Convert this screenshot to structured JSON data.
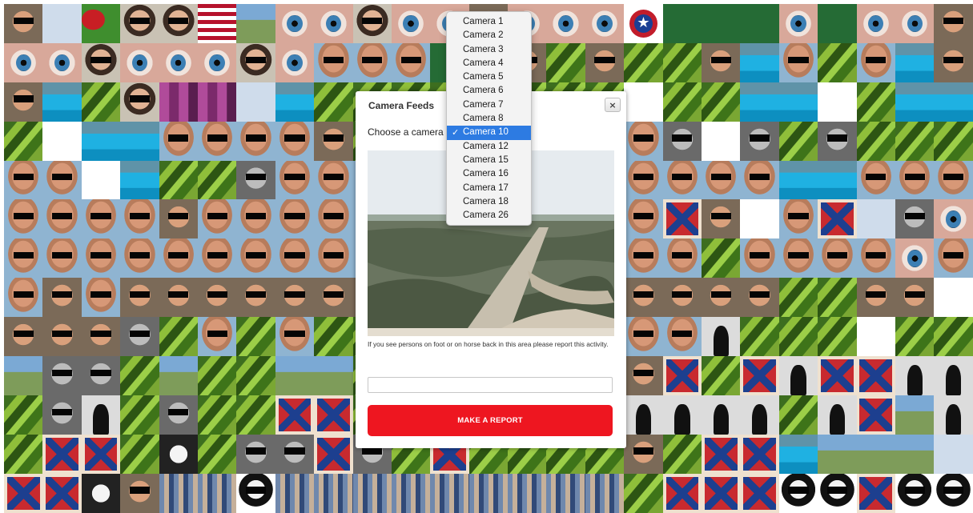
{
  "modal": {
    "title": "Camera Feeds",
    "close_icon": "×",
    "choose_label": "Choose a camera",
    "instructions": "If you see persons on foot or on horse back in this area please report this activity.",
    "report_input_value": "",
    "report_button_label": "MAKE A REPORT"
  },
  "dropdown": {
    "selected": "Camera 10",
    "options": [
      "Camera 1",
      "Camera 2",
      "Camera 3",
      "Camera 4",
      "Camera 5",
      "Camera 6",
      "Camera 7",
      "Camera 8",
      "Camera 10",
      "Camera 12",
      "Camera 15",
      "Camera 16",
      "Camera 17",
      "Camera 18",
      "Camera 26"
    ],
    "check_icon": "✓"
  },
  "colors": {
    "report_button": "#ee1620",
    "selected_option": "#2d7be2"
  },
  "mosaic": {
    "columns": 25,
    "rows": [
      [
        "face",
        "avatar",
        "straw",
        "face2",
        "face2",
        "usa",
        "road",
        "eye",
        "eye",
        "face2",
        "eye",
        "eye",
        "face",
        "eye",
        "eye",
        "eye",
        "star",
        "green",
        "green",
        "green",
        "eye",
        "green",
        "eye",
        "eye",
        "face"
      ],
      [
        "eye",
        "eye",
        "face2",
        "eye",
        "eye",
        "eye",
        "face2",
        "eye",
        "bald",
        "bald",
        "bald",
        "green",
        "eye",
        "face",
        "leaf",
        "face",
        "leaf",
        "leaf",
        "face",
        "pool",
        "bald",
        "leaf",
        "bald",
        "pool",
        "face"
      ],
      [
        "face",
        "pool",
        "leaf",
        "face2",
        "pink",
        "pink",
        "avatar",
        "pool",
        "leaf",
        "leaf",
        "leaf",
        "leaf",
        "leaf",
        "leaf",
        "leaf",
        "leaf",
        "sketch",
        "leaf",
        "leaf",
        "pool",
        "pool",
        "sketch",
        "leaf",
        "pool",
        "pool"
      ],
      [
        "leaf",
        "sketch",
        "pool",
        "pool",
        "bald",
        "bald",
        "bald",
        "bald",
        "face",
        "leaf",
        "leaf",
        "leaf",
        "leaf",
        "leaf",
        "leaf",
        "leaf",
        "bald",
        "gray",
        "sketch",
        "gray",
        "leaf",
        "gray",
        "leaf",
        "leaf",
        "leaf"
      ],
      [
        "bald",
        "bald",
        "sketch",
        "pool",
        "leaf",
        "leaf",
        "gray",
        "bald",
        "bald",
        "bald",
        "bald",
        "bald",
        "bald",
        "bald",
        "bald",
        "bald",
        "bald",
        "bald",
        "bald",
        "bald",
        "pool",
        "pool",
        "bald",
        "bald",
        "bald"
      ],
      [
        "bald",
        "bald",
        "bald",
        "bald",
        "face",
        "bald",
        "bald",
        "bald",
        "bald",
        "bald",
        "bald",
        "bald",
        "bald",
        "bald",
        "bald",
        "bald",
        "bald",
        "flag",
        "face",
        "sketch",
        "bald",
        "flag",
        "avatar",
        "gray",
        "eye"
      ],
      [
        "bald",
        "bald",
        "bald",
        "bald",
        "bald",
        "bald",
        "bald",
        "bald",
        "bald",
        "bald",
        "bald",
        "bald",
        "bald",
        "bald",
        "bald",
        "bald",
        "bald",
        "bald",
        "leaf",
        "bald",
        "bald",
        "bald",
        "bald",
        "eye",
        "bald"
      ],
      [
        "bald",
        "face",
        "bald",
        "face",
        "face",
        "face",
        "face",
        "face",
        "face",
        "face",
        "face",
        "face",
        "face",
        "face",
        "face",
        "face",
        "face",
        "face",
        "face",
        "face",
        "leaf",
        "leaf",
        "face",
        "face",
        "sketch"
      ],
      [
        "face",
        "face",
        "face",
        "gray",
        "leaf",
        "bald",
        "leaf",
        "bald",
        "leaf",
        "leaf",
        "leaf",
        "leaf",
        "leaf",
        "leaf",
        "leaf",
        "leaf",
        "bald",
        "bald",
        "silh",
        "leaf",
        "leaf",
        "leaf",
        "sketch",
        "leaf",
        "leaf"
      ],
      [
        "road",
        "gray",
        "gray",
        "leaf",
        "road",
        "leaf",
        "leaf",
        "road",
        "road",
        "leaf",
        "leaf",
        "leaf",
        "leaf",
        "leaf",
        "leaf",
        "leaf",
        "face",
        "flag",
        "leaf",
        "flag",
        "silh",
        "flag",
        "flag",
        "silh",
        "silh"
      ],
      [
        "leaf",
        "gray",
        "silh",
        "leaf",
        "gray",
        "leaf",
        "leaf",
        "flag",
        "flag",
        "leaf",
        "leaf",
        "leaf",
        "leaf",
        "leaf",
        "leaf",
        "leaf",
        "silh",
        "silh",
        "silh",
        "silh",
        "leaf",
        "silh",
        "flag",
        "road",
        "silh"
      ],
      [
        "leaf",
        "flag",
        "flag",
        "leaf",
        "dog",
        "leaf",
        "gray",
        "gray",
        "flag",
        "gray",
        "leaf",
        "flag",
        "leaf",
        "leaf",
        "leaf",
        "leaf",
        "face",
        "leaf",
        "flag",
        "flag",
        "pool",
        "road",
        "road",
        "road",
        "avatar"
      ],
      [
        "flag",
        "flag",
        "dog",
        "face",
        "crowd",
        "crowd",
        "lady",
        "crowd",
        "crowd",
        "crowd",
        "crowd",
        "crowd",
        "crowd",
        "crowd",
        "crowd",
        "crowd",
        "leaf",
        "flag",
        "flag",
        "flag",
        "lady",
        "lady",
        "flag",
        "lady",
        "lady"
      ]
    ]
  }
}
